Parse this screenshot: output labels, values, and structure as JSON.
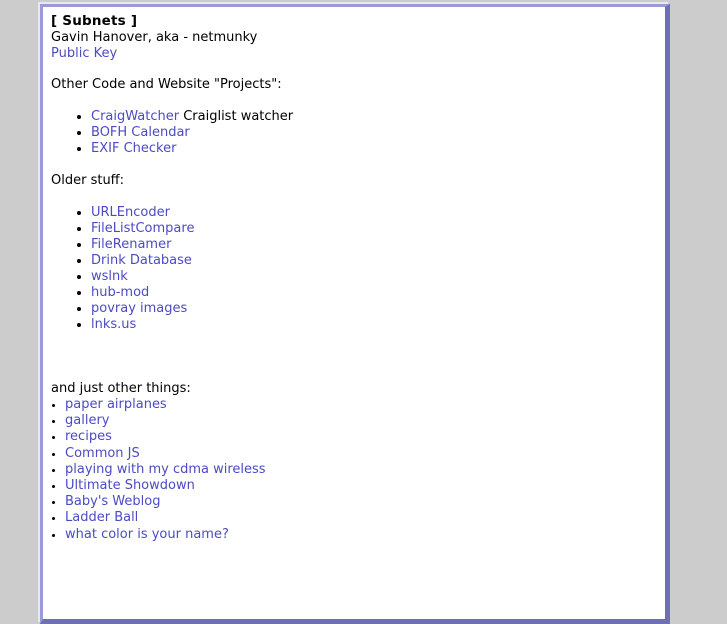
{
  "page": {
    "background_color": "#cccccc",
    "content_background": "#ffffff",
    "border_color_light": "#9a9ad6",
    "border_color_dark": "#6f6fb5",
    "link_color": "#4b4bc4",
    "text_color": "#000000"
  },
  "header": {
    "title": "[ Subnets ]",
    "byline": "Gavin Hanover, aka - netmunky",
    "public_key_link": "Public Key"
  },
  "projects": {
    "heading": "Other Code and Website \"Projects\":",
    "items": [
      {
        "link": "CraigWatcher",
        "suffix": " Craiglist watcher"
      },
      {
        "link": "BOFH Calendar",
        "suffix": ""
      },
      {
        "link": "EXIF Checker",
        "suffix": ""
      }
    ]
  },
  "older": {
    "heading": "Older stuff:",
    "items": [
      {
        "link": "URLEncoder",
        "suffix": ""
      },
      {
        "link": "FileListCompare",
        "suffix": ""
      },
      {
        "link": "FileRenamer",
        "suffix": ""
      },
      {
        "link": "Drink Database",
        "suffix": ""
      },
      {
        "link": "wslnk",
        "suffix": ""
      },
      {
        "link": "hub-mod",
        "suffix": ""
      },
      {
        "link": "povray images",
        "suffix": ""
      },
      {
        "link": "lnks.us",
        "suffix": ""
      }
    ]
  },
  "other_things": {
    "heading": "and just other things:",
    "items": [
      {
        "link": "paper airplanes",
        "suffix": ""
      },
      {
        "link": "gallery",
        "suffix": ""
      },
      {
        "link": "recipes",
        "suffix": ""
      },
      {
        "link": "Common JS",
        "suffix": ""
      },
      {
        "link": "playing with my cdma wireless",
        "suffix": ""
      },
      {
        "link": "Ultimate Showdown",
        "suffix": ""
      },
      {
        "link": "Baby's Weblog",
        "suffix": ""
      },
      {
        "link": "Ladder Ball",
        "suffix": ""
      },
      {
        "link": "what color is your name?",
        "suffix": ""
      }
    ]
  }
}
